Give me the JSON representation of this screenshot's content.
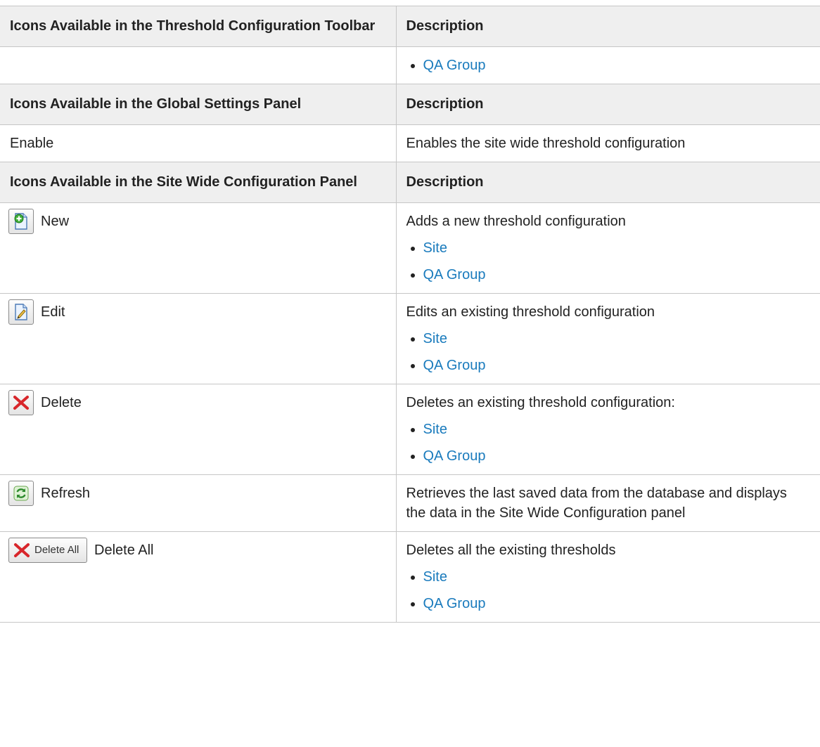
{
  "colors": {
    "link": "#1a7bbd",
    "header_bg": "#efefef",
    "border": "#c6c6c6"
  },
  "sections": [
    {
      "header": {
        "col1": "Icons Available in the Threshold Configuration Toolbar",
        "col2": "Description"
      },
      "rows": [
        {
          "icon": null,
          "label": "",
          "description": "",
          "links": [
            "QA Group"
          ]
        }
      ]
    },
    {
      "header": {
        "col1": "Icons Available in the Global Settings Panel",
        "col2": "Description"
      },
      "rows": [
        {
          "icon": null,
          "label": "Enable",
          "description": "Enables the site wide threshold configuration",
          "links": []
        }
      ]
    },
    {
      "header": {
        "col1": "Icons Available in the Site Wide Configuration Panel",
        "col2": "Description"
      },
      "rows": [
        {
          "icon": "new-document-icon",
          "label": "New",
          "description": "Adds a new threshold configuration",
          "links": [
            "Site",
            "QA Group"
          ]
        },
        {
          "icon": "edit-document-icon",
          "label": "Edit",
          "description": "Edits an existing threshold configuration",
          "links": [
            "Site",
            "QA Group"
          ]
        },
        {
          "icon": "delete-x-icon",
          "label": "Delete",
          "description": "Deletes an existing threshold configuration:",
          "links": [
            "Site",
            "QA Group"
          ]
        },
        {
          "icon": "refresh-icon",
          "label": "Refresh",
          "description": "Retrieves the last saved data from the database and displays the data in the Site Wide Configuration panel",
          "links": []
        },
        {
          "icon": "delete-all-icon",
          "button_text": "Delete All",
          "label": "Delete All",
          "description": "Deletes all the existing thresholds",
          "links": [
            "Site",
            "QA Group"
          ]
        }
      ]
    }
  ]
}
